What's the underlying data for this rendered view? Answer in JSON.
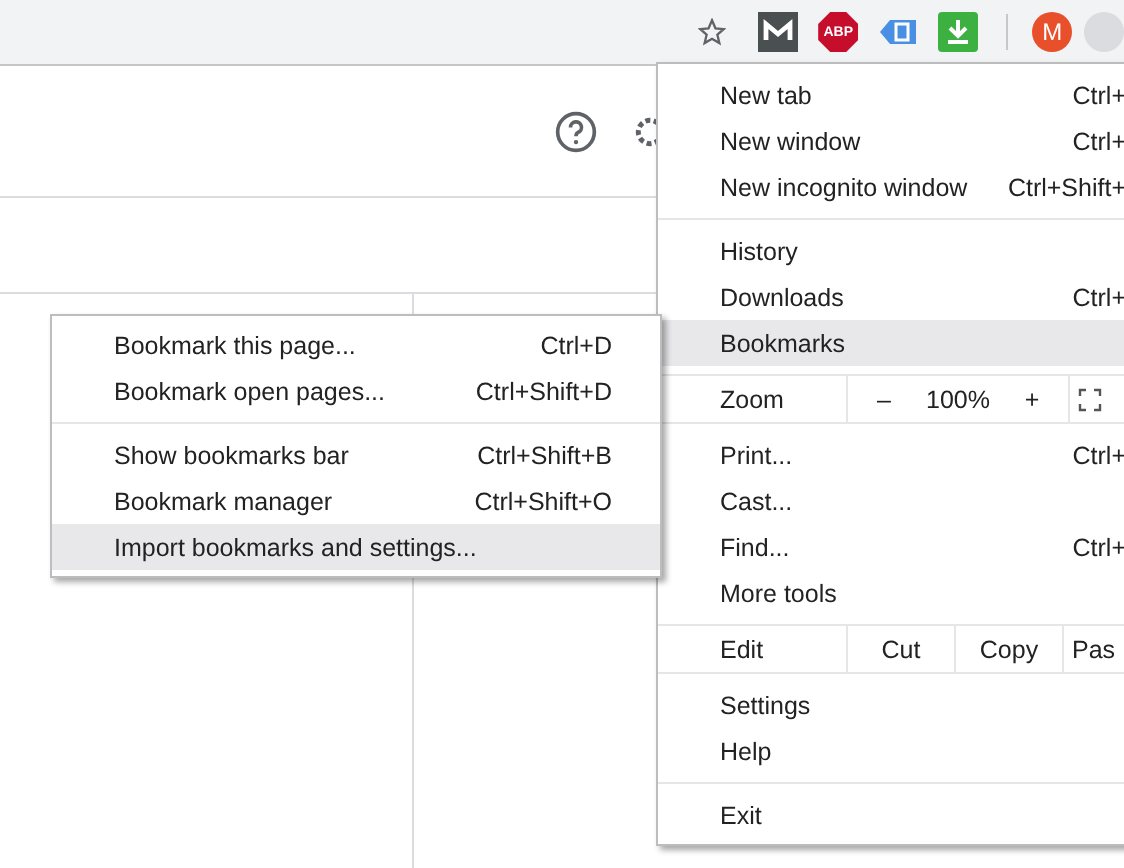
{
  "toolbar": {
    "extensions": [
      {
        "kind": "mark"
      },
      {
        "kind": "stop-sign",
        "label": "ABP"
      },
      {
        "kind": "tag"
      },
      {
        "kind": "download"
      }
    ],
    "avatar": "M"
  },
  "main_menu": {
    "sections": [
      [
        {
          "kind": "item",
          "label": "New tab",
          "shortcut": "Ctrl+",
          "selected": false
        },
        {
          "kind": "item",
          "label": "New window",
          "shortcut": "Ctrl+",
          "selected": false
        },
        {
          "kind": "item",
          "label": "New incognito window",
          "shortcut": "Ctrl+Shift+",
          "selected": false
        }
      ],
      [
        {
          "kind": "item",
          "label": "History",
          "selected": false
        },
        {
          "kind": "item",
          "label": "Downloads",
          "shortcut": "Ctrl+",
          "selected": false
        },
        {
          "kind": "item",
          "label": "Bookmarks",
          "selected": true
        }
      ],
      [
        {
          "kind": "zoom",
          "label": "Zoom",
          "minus": "–",
          "value": "100%",
          "plus": "+"
        }
      ],
      [
        {
          "kind": "item",
          "label": "Print...",
          "shortcut": "Ctrl+",
          "selected": false
        },
        {
          "kind": "item",
          "label": "Cast...",
          "selected": false
        },
        {
          "kind": "item",
          "label": "Find...",
          "shortcut": "Ctrl+",
          "selected": false
        },
        {
          "kind": "item",
          "label": "More tools",
          "selected": false
        }
      ],
      [
        {
          "kind": "edit",
          "label": "Edit",
          "actions": [
            "Cut",
            "Copy",
            "Pas"
          ]
        }
      ],
      [
        {
          "kind": "item",
          "label": "Settings",
          "selected": false
        },
        {
          "kind": "item",
          "label": "Help",
          "selected": false
        }
      ],
      [
        {
          "kind": "item",
          "label": "Exit",
          "selected": false
        }
      ]
    ]
  },
  "bookmarks_submenu": {
    "sections": [
      [
        {
          "label": "Bookmark this page...",
          "shortcut": "Ctrl+D",
          "selected": false
        },
        {
          "label": "Bookmark open pages...",
          "shortcut": "Ctrl+Shift+D",
          "selected": false
        }
      ],
      [
        {
          "label": "Show bookmarks bar",
          "shortcut": "Ctrl+Shift+B",
          "selected": false
        },
        {
          "label": "Bookmark manager",
          "shortcut": "Ctrl+Shift+O",
          "selected": false
        },
        {
          "label": "Import bookmarks and settings...",
          "selected": true
        }
      ]
    ]
  }
}
